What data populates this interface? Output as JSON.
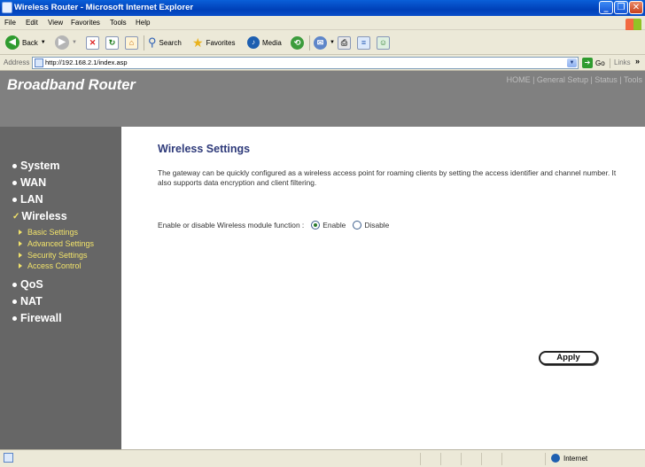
{
  "window": {
    "title": "Wireless Router - Microsoft Internet Explorer"
  },
  "menu": [
    "File",
    "Edit",
    "View",
    "Favorites",
    "Tools",
    "Help"
  ],
  "toolbar": {
    "back": "Back",
    "search": "Search",
    "favorites": "Favorites",
    "media": "Media"
  },
  "address": {
    "label": "Address",
    "url": "http://192.168.2.1/index.asp",
    "go": "Go",
    "links": "Links"
  },
  "router": {
    "brand": "Broadband Router",
    "topnav": "HOME | General Setup | Status | Tools"
  },
  "sidebar": {
    "items": [
      {
        "label": "System"
      },
      {
        "label": "WAN"
      },
      {
        "label": "LAN"
      },
      {
        "label": "Wireless",
        "active": true
      },
      {
        "label": "QoS"
      },
      {
        "label": "NAT"
      },
      {
        "label": "Firewall"
      }
    ],
    "subitems": [
      "Basic Settings",
      "Advanced Settings",
      "Security Settings",
      "Access Control"
    ]
  },
  "content": {
    "title": "Wireless Settings",
    "description": "The gateway can be quickly configured as a wireless access point for roaming clients by setting the access identifier and channel number. It also supports data encryption and client filtering.",
    "toggle_label": "Enable or disable Wireless module function :",
    "enable_label": "Enable",
    "disable_label": "Disable",
    "selected": "Enable",
    "apply_label": "Apply"
  },
  "status": {
    "zone": "Internet"
  }
}
